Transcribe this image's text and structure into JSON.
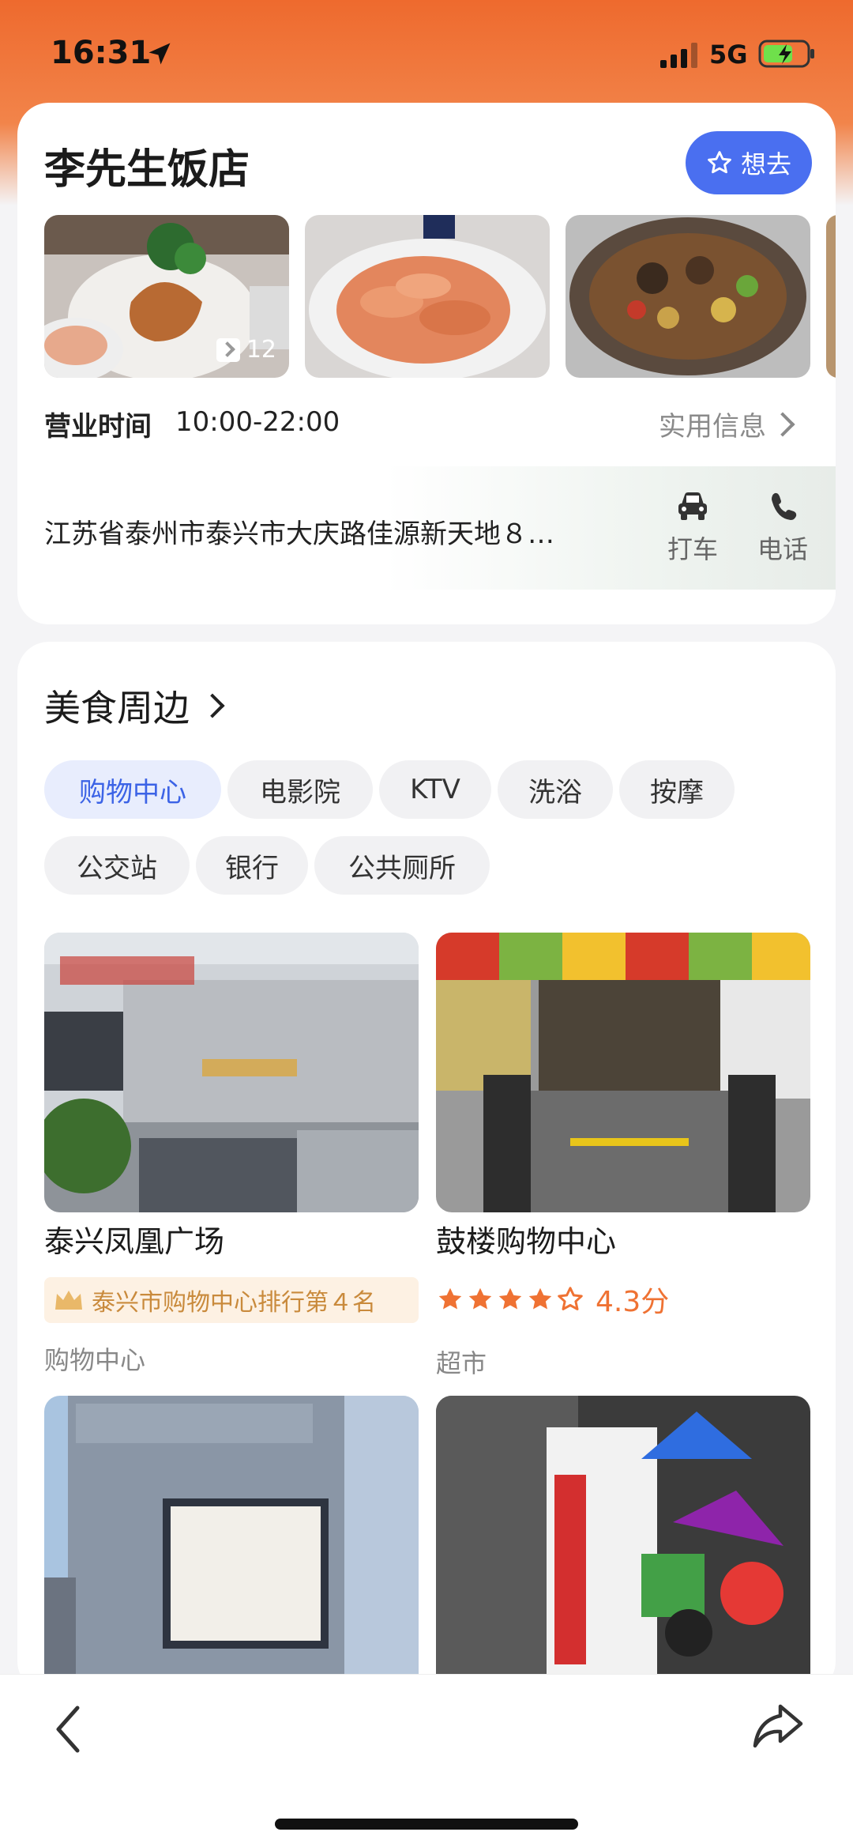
{
  "status_bar": {
    "time": "16:31",
    "network": "5G"
  },
  "shop": {
    "name": "李先生饭店",
    "want_button": "想去",
    "photo_count": "12",
    "hours_label": "营业时间",
    "hours_value": "10:00-22:00",
    "info_link": "实用信息",
    "address": "江苏省泰州市泰兴市大庆路佳源新天地８…",
    "actions": {
      "taxi": "打车",
      "phone": "电话"
    }
  },
  "nearby": {
    "title": "美食周边",
    "chips": [
      "购物中心",
      "电影院",
      "KTV",
      "洗浴",
      "按摩",
      "公交站",
      "银行",
      "公共厕所"
    ],
    "active_chip": "购物中心",
    "places": [
      {
        "name": "泰兴凤凰广场",
        "rank": "泰兴市购物中心排行第４名",
        "category": "购物中心"
      },
      {
        "name": "鼓楼购物中心",
        "stars": 4.3,
        "score": "4.3分",
        "category": "超市"
      }
    ]
  },
  "colors": {
    "accent_blue": "#4a6ff0",
    "header_orange": "#ee6a2e",
    "star_orange": "#ef7233"
  },
  "icons": [
    "location-arrow-icon",
    "signal-icon",
    "battery-icon",
    "star-outline-icon",
    "photo-icon",
    "car-icon",
    "phone-icon",
    "chevron-right-icon",
    "crown-icon",
    "back-icon",
    "share-icon"
  ]
}
